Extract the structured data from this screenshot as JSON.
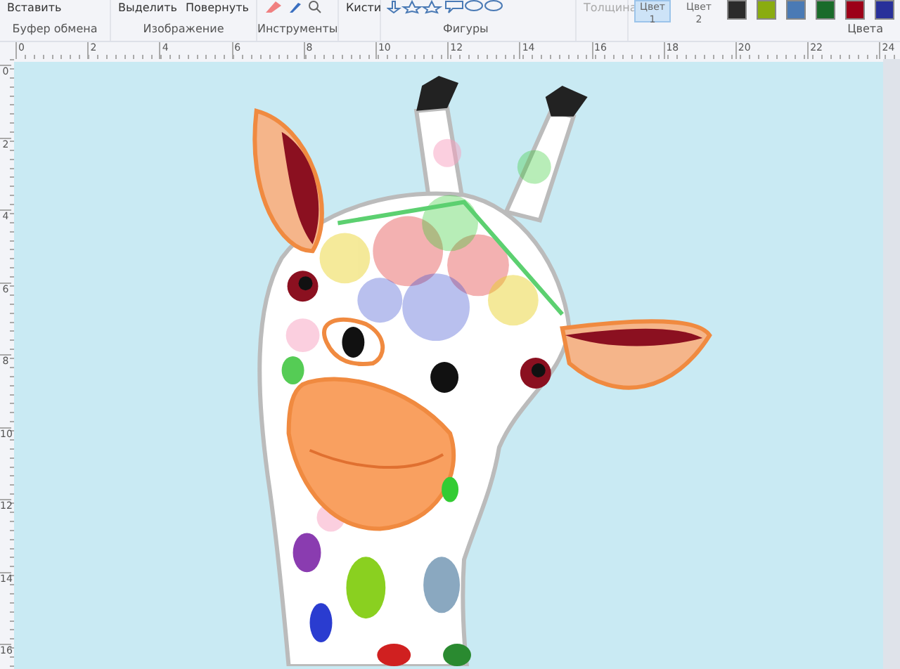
{
  "clipboard": {
    "paste": "Вставить",
    "label": "Буфер обмена"
  },
  "image": {
    "select": "Выделить",
    "rotate": "Повернуть",
    "label": "Изображение"
  },
  "tools": {
    "label": "Инструменты"
  },
  "brushes": {
    "label": "Кисти"
  },
  "shapes": {
    "label": "Фигуры"
  },
  "size": {
    "label": "Толщина"
  },
  "color_slots": [
    {
      "label": "Цвет",
      "number": "1",
      "selected": true
    },
    {
      "label": "Цвет",
      "number": "2",
      "selected": false
    }
  ],
  "palette": [
    {
      "color": "#2b2b2b"
    },
    {
      "color": "#8aac10"
    },
    {
      "color": "#4a7ab5"
    },
    {
      "color": "#1a6b2a"
    },
    {
      "color": "#9c0018"
    },
    {
      "color": "#28309a"
    }
  ],
  "colors_label": "Цвета",
  "ruler": {
    "horizontal": [
      "0",
      "2",
      "4",
      "6",
      "8",
      "10",
      "12",
      "14",
      "16",
      "18",
      "20",
      "22",
      "24"
    ],
    "vertical": [
      "0",
      "2",
      "4",
      "6",
      "8",
      "10",
      "12",
      "14",
      "16"
    ]
  }
}
